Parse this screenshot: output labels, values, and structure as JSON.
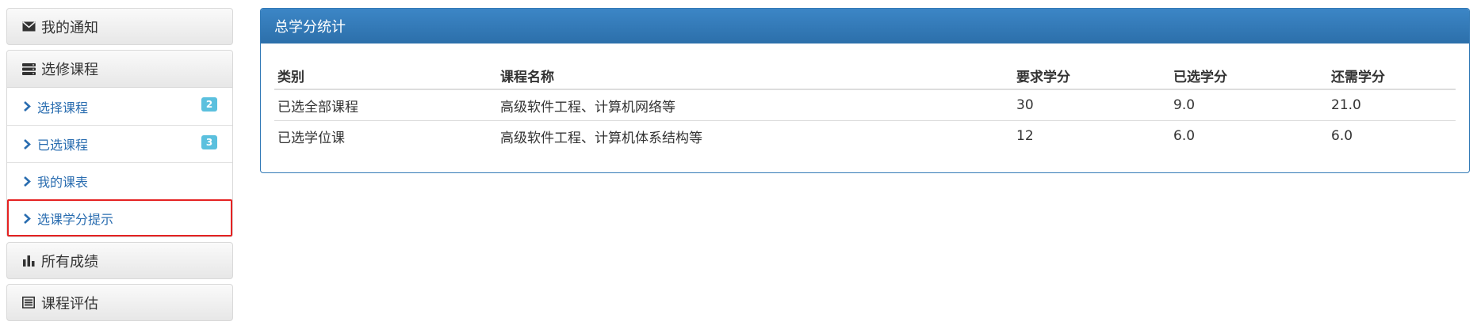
{
  "sidebar": {
    "notifications": {
      "label": "我的通知",
      "icon": "envelope-icon"
    },
    "elective": {
      "label": "选修课程",
      "icon": "stack-icon",
      "items": [
        {
          "label": "选择课程",
          "badge": "2"
        },
        {
          "label": "已选课程",
          "badge": "3"
        },
        {
          "label": "我的课表"
        },
        {
          "label": "选课学分提示",
          "selected": true
        }
      ]
    },
    "grades": {
      "label": "所有成绩",
      "icon": "bar-chart-icon"
    },
    "evaluation": {
      "label": "课程评估",
      "icon": "list-alt-icon"
    }
  },
  "panel": {
    "title": "总学分统计",
    "table": {
      "headers": [
        "类别",
        "课程名称",
        "要求学分",
        "已选学分",
        "还需学分"
      ],
      "rows": [
        [
          "已选全部课程",
          "高级软件工程、计算机网络等",
          "30",
          "9.0",
          "21.0"
        ],
        [
          "已选学位课",
          "高级软件工程、计算机体系结构等",
          "12",
          "6.0",
          "6.0"
        ]
      ]
    }
  },
  "colors": {
    "panel_header": "#337ab7",
    "link": "#2a6db0",
    "badge": "#5bc0de",
    "selected_outline": "#e52222"
  }
}
